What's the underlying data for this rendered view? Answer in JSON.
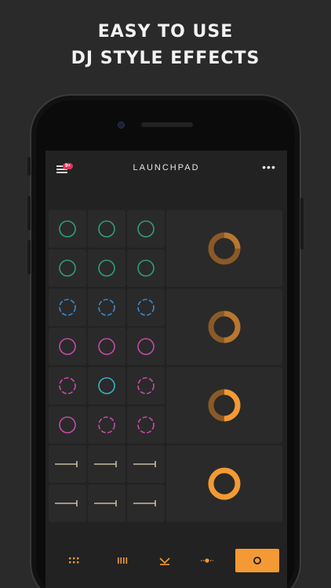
{
  "headline": {
    "line1": "EASY TO USE",
    "line2": "DJ STYLE EFFECTS"
  },
  "app": {
    "title": "LAUNCHPAD",
    "menu_badge": "9+",
    "menu_icon": "hamburger-icon",
    "more_label": "•••"
  },
  "colors": {
    "green": "#2f9e78",
    "blue": "#3f86c9",
    "pink": "#c54aa6",
    "teal": "#3ab0c4",
    "tan": "#c8b9a2",
    "orange": "#f39a34",
    "orange_dim": "#8a5a26",
    "background": "#222222",
    "cell": "#2a2a2a"
  },
  "groups": [
    {
      "rows": [
        [
          "green-solid",
          "green-solid",
          "green-solid"
        ],
        [
          "green-solid",
          "green-solid",
          "green-solid"
        ]
      ],
      "knob": {
        "level": 0.25,
        "bright": false
      }
    },
    {
      "rows": [
        [
          "blue-dashed",
          "blue-dashed",
          "blue-dashed"
        ],
        [
          "pink-solid",
          "pink-solid",
          "pink-solid"
        ]
      ],
      "knob": {
        "level": 0.5,
        "bright": false
      }
    },
    {
      "rows": [
        [
          "pink-dashed",
          "teal-solid",
          "pink-dashed"
        ],
        [
          "pink-solid",
          "pink-dashed",
          "pink-dashed"
        ]
      ],
      "knob": {
        "level": 0.5,
        "bright": true
      }
    },
    {
      "rows": [
        [
          "tan-fader",
          "tan-fader",
          "tan-fader"
        ],
        [
          "tan-fader",
          "tan-fader",
          "tan-fader"
        ]
      ],
      "knob": {
        "level": 1.0,
        "bright": true
      }
    }
  ],
  "tabs": [
    {
      "icon": "grid-dots-icon",
      "active": false
    },
    {
      "icon": "bars-icon",
      "active": false
    },
    {
      "icon": "crossfade-icon",
      "active": false
    },
    {
      "icon": "slider-dot-icon",
      "active": false
    },
    {
      "icon": "circle-icon",
      "active": true
    }
  ]
}
